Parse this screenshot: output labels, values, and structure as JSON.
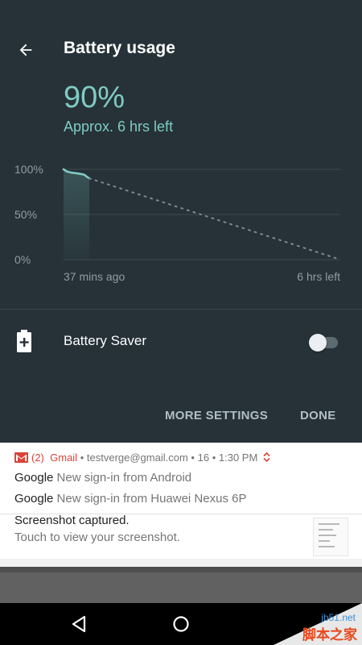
{
  "header": {
    "title": "Battery usage"
  },
  "battery": {
    "percent_text": "90%",
    "time_left": "Approx. 6 hrs left"
  },
  "chart_data": {
    "type": "line",
    "y_ticks": [
      "100%",
      "50%",
      "0%"
    ],
    "x_labels": [
      "37 mins ago",
      "6 hrs left"
    ],
    "ylim": [
      0,
      100
    ],
    "grid": true,
    "series": [
      {
        "kind": "actual",
        "x_minutes": [
          0,
          5,
          10,
          15,
          20,
          25,
          30,
          33,
          37
        ],
        "y": [
          100,
          97.5,
          96.5,
          96.0,
          95.5,
          94.8,
          94.0,
          92.0,
          90.0
        ]
      },
      {
        "kind": "projected",
        "x_minutes": [
          37,
          397
        ],
        "y": [
          90,
          0
        ]
      }
    ],
    "colors": {
      "line": "#80cbc4",
      "grid": "#3e4b51"
    }
  },
  "battery_saver": {
    "label": "Battery Saver",
    "enabled": false,
    "icon": "battery-saver-icon"
  },
  "actions": {
    "more_settings": "MORE SETTINGS",
    "done": "DONE"
  },
  "notifications": {
    "gmail": {
      "count": "(2)",
      "app": "Gmail",
      "account": "testverge@gmail.com",
      "number": "16",
      "time": "1:30 PM",
      "rows": [
        {
          "sender": "Google",
          "text": "New sign-in from Android"
        },
        {
          "sender": "Google",
          "text": "New sign-in from Huawei Nexus 6P"
        }
      ]
    },
    "screenshot": {
      "title": "Screenshot captured.",
      "subtitle": "Touch to view your screenshot."
    }
  },
  "navigation": {
    "back_icon": "back-triangle-icon",
    "home_icon": "home-circle-icon"
  },
  "watermark": {
    "domain": "jb51.net",
    "brand": "脚本之家"
  },
  "colors": {
    "panel_bg": "#263238",
    "accent": "#80cbc4",
    "gmail_red": "#db4437"
  }
}
